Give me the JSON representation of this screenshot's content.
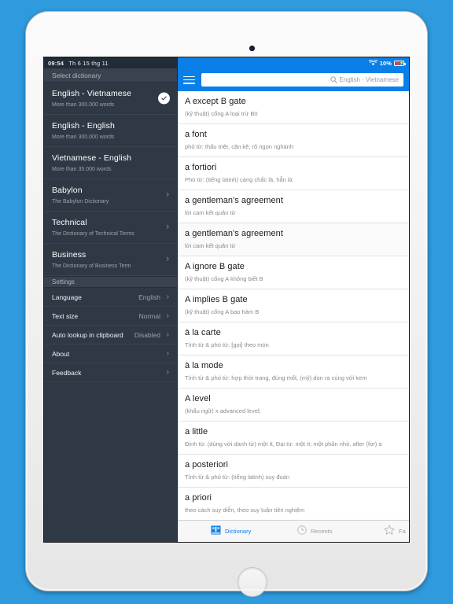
{
  "device": {
    "name": "iPad",
    "camera": "front-camera",
    "home": "home-button"
  },
  "status_bar": {
    "time": "09:54",
    "date": "Th 6 15 thg 11",
    "wifi": "wifi-icon",
    "battery_percent": "10%",
    "battery_state": "charging"
  },
  "sidebar": {
    "header": "Select dictionary",
    "dictionaries": [
      {
        "title": "English - Vietnamese",
        "subtitle": "More than 300.000 words",
        "selected": true,
        "chevron": false
      },
      {
        "title": "English - English",
        "subtitle": "More than 300.000 words",
        "selected": false,
        "chevron": false
      },
      {
        "title": "Vietnamese - English",
        "subtitle": "More than 35.000 words",
        "selected": false,
        "chevron": false
      },
      {
        "title": "Babylon",
        "subtitle": "The Babylon Dictionary",
        "selected": false,
        "chevron": true
      },
      {
        "title": "Technical",
        "subtitle": "The Dictionary of Technical Terms",
        "selected": false,
        "chevron": true
      },
      {
        "title": "Business",
        "subtitle": "The Dictionary of Business Term",
        "selected": false,
        "chevron": true
      }
    ],
    "settings_header": "Settings",
    "settings": [
      {
        "label": "Language",
        "value": "English"
      },
      {
        "label": "Text size",
        "value": "Normal"
      },
      {
        "label": "Auto lookup in clipboard",
        "value": "Disabled"
      },
      {
        "label": "About",
        "value": ""
      },
      {
        "label": "Feedback",
        "value": ""
      }
    ]
  },
  "main": {
    "menu_icon": "hamburger-menu-icon",
    "search": {
      "value": "",
      "placeholder": "English - Vietnamese",
      "icon": "search-icon"
    },
    "entries": [
      {
        "term": "A except B gate",
        "definition": "(kỹ thuật) cổng A loại trừ B0"
      },
      {
        "term": "a font",
        "definition": "phó từ: thấu triệt, cặn kẽ, rõ ngọn nghành"
      },
      {
        "term": "a fortiori",
        "definition": "Phó từ: (tiếng latinh) càng chắc là, hẳn là"
      },
      {
        "term": "a gentleman's agreement",
        "definition": "lời cam kết quân tử"
      },
      {
        "term": "a gentleman's agreement",
        "definition": "lời cam kết quân tử"
      },
      {
        "term": "A ignore B gate",
        "definition": "(kỹ thuật) cổng A không biết B"
      },
      {
        "term": "A implies B gate",
        "definition": "(kỹ thuật) cổng A bao hàm B"
      },
      {
        "term": "à la carte",
        "definition": "Tính từ & phó từ: [gọi] theo món"
      },
      {
        "term": "à la mode",
        "definition": "Tính từ & phó từ: hợp thời trang, đúng mốt, (mỹ) dọn ra cùng với kem"
      },
      {
        "term": "A level",
        "definition": "(khẩu ngữ) x advanced level;"
      },
      {
        "term": "a little",
        "definition": "Định từ: (dùng với danh từ) một ít, Đại từ: một ít; một phần nhỏ, after (for) a"
      },
      {
        "term": "a posteriori",
        "definition": "Tính từ & phó từ: (tiếng latinh) suy đoán"
      },
      {
        "term": "a priori",
        "definition": "theo cách suy diễn, theo suy luận tiên nghiệm"
      }
    ],
    "tabs": [
      {
        "label": "Dictionary",
        "icon": "book-icon",
        "active": true
      },
      {
        "label": "Recents",
        "icon": "clock-icon",
        "active": false
      },
      {
        "label": "Fa",
        "icon": "star-icon",
        "active": false
      }
    ]
  },
  "colors": {
    "accent_blue": "#0a7fe8",
    "sidebar_bg": "#2e3945",
    "wallpaper": "#2f9ade"
  }
}
